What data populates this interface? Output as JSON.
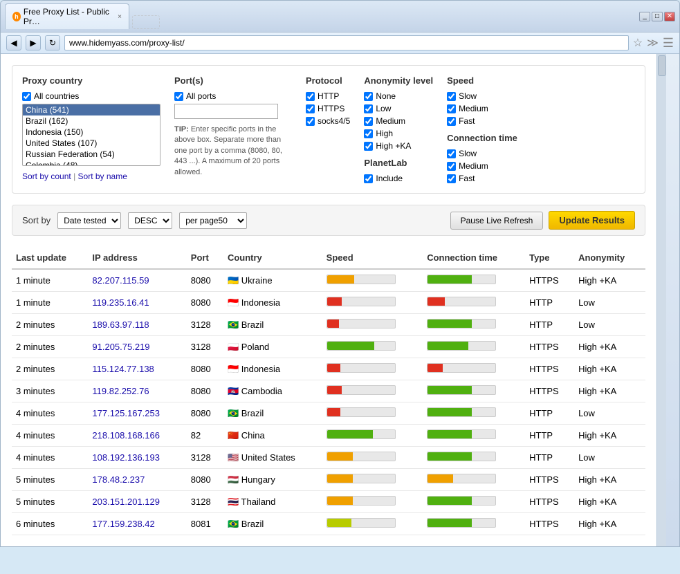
{
  "browser": {
    "title": "Free Proxy List - Public Pr…",
    "url": "www.hidemyass.com/proxy-list/",
    "tab_close": "×",
    "btn_back": "◀",
    "btn_forward": "▶",
    "btn_refresh": "↻"
  },
  "filter": {
    "proxy_country_label": "Proxy country",
    "all_countries_label": "All countries",
    "countries": [
      "China (541)",
      "Brazil (162)",
      "Indonesia (150)",
      "United States (107)",
      "Russian Federation (54)",
      "Colombia (48)"
    ],
    "sort_by_count": "Sort by count",
    "sort_by_name": "Sort by name",
    "ports_label": "Port(s)",
    "all_ports_label": "All ports",
    "port_tip": "TIP: Enter specific ports in the above box. Separate more than one port by a comma (8080, 80, 443 ...). A maximum of 20 ports allowed.",
    "protocol_label": "Protocol",
    "protocols": [
      "HTTP",
      "HTTPS",
      "socks4/5"
    ],
    "anonymity_label": "Anonymity level",
    "anonymity_levels": [
      "None",
      "Low",
      "Medium",
      "High",
      "High +KA"
    ],
    "planetlab_label": "PlanetLab",
    "planetlab_include": "Include",
    "speed_label": "Speed",
    "speed_levels": [
      "Slow",
      "Medium",
      "Fast"
    ],
    "connection_label": "Connection time",
    "connection_levels": [
      "Slow",
      "Medium",
      "Fast"
    ]
  },
  "sort_bar": {
    "sort_by_label": "Sort by",
    "sort_by_value": "Date tested",
    "order_value": "DESC",
    "per_page_value": "per page50",
    "pause_label": "Pause Live Refresh",
    "update_label": "Update Results"
  },
  "table": {
    "columns": [
      "Last update",
      "IP address",
      "Port",
      "Country",
      "Speed",
      "Connection time",
      "Type",
      "Anonymity"
    ],
    "rows": [
      {
        "update": "1 minute",
        "ip": "82.207.115.59",
        "port": "8080",
        "country": "Ukraine",
        "flag": "🇺🇦",
        "speed_pct": 40,
        "speed_color": "orange",
        "conn_pct": 65,
        "conn_color": "green",
        "type": "HTTPS",
        "anon": "High +KA"
      },
      {
        "update": "1 minute",
        "ip": "119.235.16.41",
        "port": "8080",
        "country": "Indonesia",
        "flag": "🇮🇩",
        "speed_pct": 22,
        "speed_color": "red",
        "conn_pct": 25,
        "conn_color": "red",
        "type": "HTTP",
        "anon": "Low"
      },
      {
        "update": "2 minutes",
        "ip": "189.63.97.118",
        "port": "3128",
        "country": "Brazil",
        "flag": "🇧🇷",
        "speed_pct": 18,
        "speed_color": "red",
        "conn_pct": 65,
        "conn_color": "green",
        "type": "HTTP",
        "anon": "Low"
      },
      {
        "update": "2 minutes",
        "ip": "91.205.75.219",
        "port": "3128",
        "country": "Poland",
        "flag": "🇵🇱",
        "speed_pct": 70,
        "speed_color": "green",
        "conn_pct": 60,
        "conn_color": "green",
        "type": "HTTPS",
        "anon": "High +KA"
      },
      {
        "update": "2 minutes",
        "ip": "115.124.77.138",
        "port": "8080",
        "country": "Indonesia",
        "flag": "🇮🇩",
        "speed_pct": 20,
        "speed_color": "red",
        "conn_pct": 22,
        "conn_color": "red",
        "type": "HTTPS",
        "anon": "High +KA"
      },
      {
        "update": "3 minutes",
        "ip": "119.82.252.76",
        "port": "8080",
        "country": "Cambodia",
        "flag": "🇰🇭",
        "speed_pct": 22,
        "speed_color": "red",
        "conn_pct": 65,
        "conn_color": "green",
        "type": "HTTPS",
        "anon": "High +KA"
      },
      {
        "update": "4 minutes",
        "ip": "177.125.167.253",
        "port": "8080",
        "country": "Brazil",
        "flag": "🇧🇷",
        "speed_pct": 20,
        "speed_color": "red",
        "conn_pct": 65,
        "conn_color": "green",
        "type": "HTTP",
        "anon": "Low"
      },
      {
        "update": "4 minutes",
        "ip": "218.108.168.166",
        "port": "82",
        "country": "China",
        "flag": "🇨🇳",
        "speed_pct": 68,
        "speed_color": "green",
        "conn_pct": 65,
        "conn_color": "green",
        "type": "HTTP",
        "anon": "High +KA"
      },
      {
        "update": "4 minutes",
        "ip": "108.192.136.193",
        "port": "3128",
        "country": "United States",
        "flag": "🇺🇸",
        "speed_pct": 38,
        "speed_color": "orange",
        "conn_pct": 65,
        "conn_color": "green",
        "type": "HTTP",
        "anon": "Low"
      },
      {
        "update": "5 minutes",
        "ip": "178.48.2.237",
        "port": "8080",
        "country": "Hungary",
        "flag": "🇭🇺",
        "speed_pct": 38,
        "speed_color": "orange",
        "conn_pct": 38,
        "conn_color": "orange",
        "type": "HTTPS",
        "anon": "High +KA"
      },
      {
        "update": "5 minutes",
        "ip": "203.151.201.129",
        "port": "3128",
        "country": "Thailand",
        "flag": "🇹🇭",
        "speed_pct": 38,
        "speed_color": "orange",
        "conn_pct": 65,
        "conn_color": "green",
        "type": "HTTPS",
        "anon": "High +KA"
      },
      {
        "update": "6 minutes",
        "ip": "177.159.238.42",
        "port": "8081",
        "country": "Brazil",
        "flag": "🇧🇷",
        "speed_pct": 36,
        "speed_color": "yellow-green",
        "conn_pct": 65,
        "conn_color": "green",
        "type": "HTTPS",
        "anon": "High +KA"
      }
    ]
  }
}
